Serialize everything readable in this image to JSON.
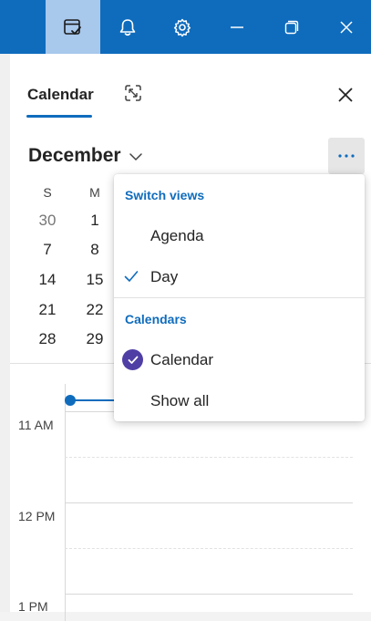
{
  "titlebar": {
    "buttons": [
      {
        "id": "calendar-check",
        "active": true
      },
      {
        "id": "bell"
      },
      {
        "id": "gear"
      },
      {
        "id": "minimize"
      },
      {
        "id": "restore"
      },
      {
        "id": "close"
      }
    ],
    "color": "#0f6cbd"
  },
  "pane": {
    "tab_label": "Calendar",
    "month_label": "December",
    "more_label": "···"
  },
  "mini_calendar": {
    "weekdays": [
      "S",
      "M"
    ],
    "weeks": [
      [
        "30",
        "1"
      ],
      [
        "7",
        "8"
      ],
      [
        "14",
        "15"
      ],
      [
        "21",
        "22"
      ],
      [
        "28",
        "29"
      ]
    ]
  },
  "timeline": {
    "hours": [
      "11 AM",
      "12 PM",
      "1 PM"
    ]
  },
  "menu": {
    "switch_views_header": "Switch views",
    "views": [
      {
        "label": "Agenda",
        "checked": false
      },
      {
        "label": "Day",
        "checked": true
      }
    ],
    "calendars_header": "Calendars",
    "calendars": [
      {
        "label": "Calendar",
        "color": "#4f3fa5",
        "checked": true
      },
      {
        "label": "Show all"
      }
    ]
  }
}
